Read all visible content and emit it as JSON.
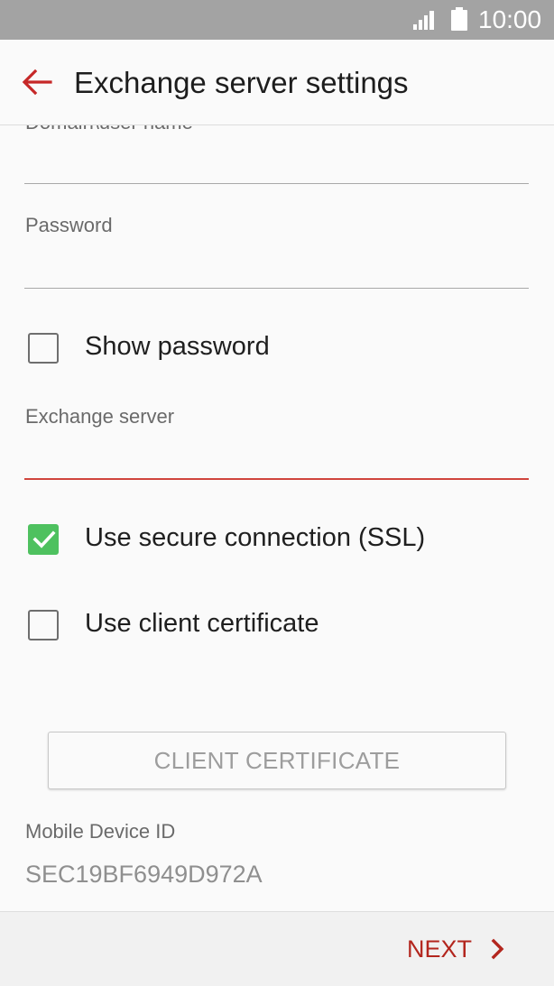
{
  "status_bar": {
    "time": "10:00",
    "icons": [
      "signal-icon",
      "battery-icon"
    ]
  },
  "app_bar": {
    "title": "Exchange server settings",
    "back_icon": "back-arrow-icon"
  },
  "form": {
    "partial_field_label": "Domain\\user name",
    "password_label": "Password",
    "password_value": "",
    "show_password_label": "Show password",
    "show_password_checked": false,
    "exchange_server_label": "Exchange server",
    "exchange_server_value": "",
    "ssl_label": "Use secure connection (SSL)",
    "ssl_checked": true,
    "client_cert_label": "Use client certificate",
    "client_cert_checked": false,
    "client_cert_button": "CLIENT CERTIFICATE",
    "mobile_device_id_label": "Mobile Device ID",
    "mobile_device_id_value": "SEC19BF6949D972A"
  },
  "footer": {
    "next_label": "NEXT",
    "next_icon": "chevron-right-icon"
  },
  "colors": {
    "accent": "#b3261e",
    "active_underline": "#d0453d",
    "checkbox_checked": "#4ec15f",
    "status_bar": "#a3a3a3"
  }
}
